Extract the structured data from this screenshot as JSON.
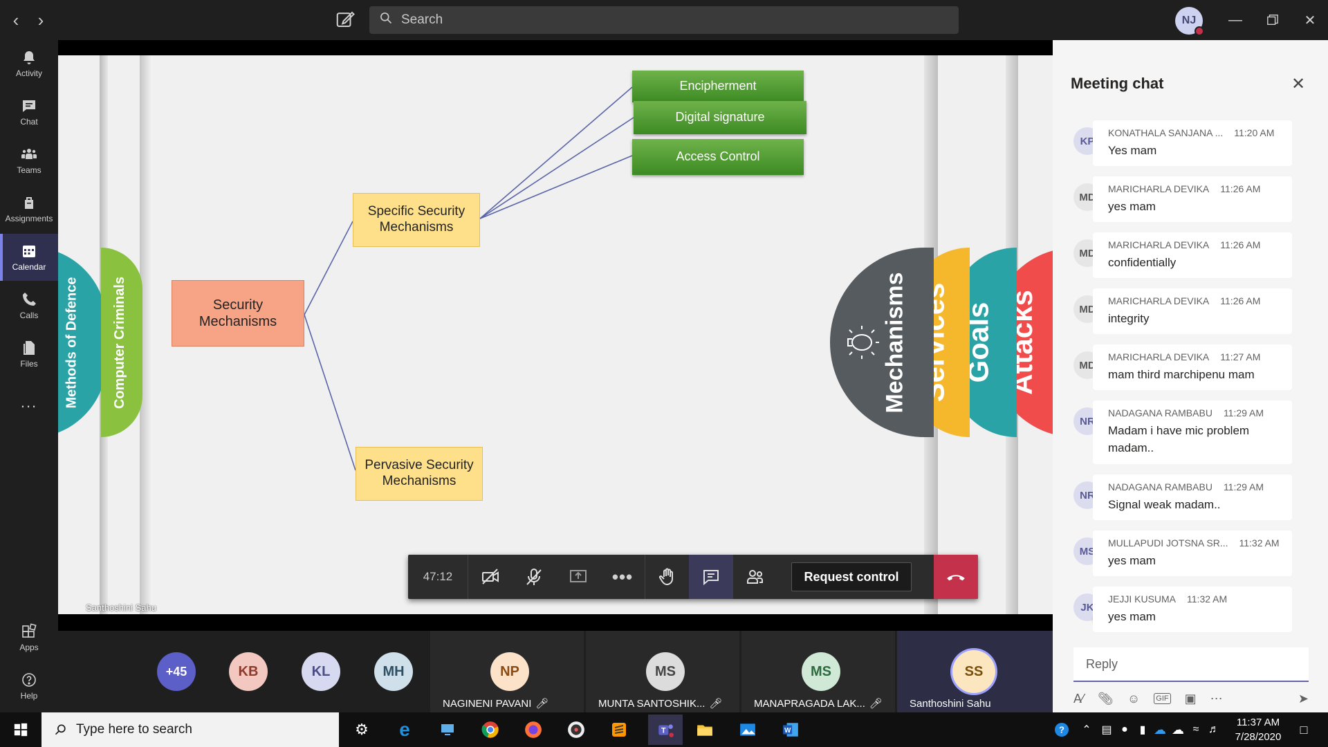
{
  "titlebar": {
    "search_placeholder": "Search",
    "user_initials": "NJ"
  },
  "rail": {
    "items": [
      {
        "label": "Activity",
        "icon": "bell-icon"
      },
      {
        "label": "Chat",
        "icon": "chat-icon"
      },
      {
        "label": "Teams",
        "icon": "teams-icon"
      },
      {
        "label": "Assignments",
        "icon": "assignments-icon"
      },
      {
        "label": "Calendar",
        "icon": "calendar-icon",
        "active": true
      },
      {
        "label": "Calls",
        "icon": "phone-icon"
      },
      {
        "label": "Files",
        "icon": "files-icon"
      }
    ],
    "more": "...",
    "apps_label": "Apps",
    "help_label": "Help"
  },
  "slide": {
    "left_tabs": [
      "Methods of Defence",
      "Computer Criminals"
    ],
    "right_tabs": [
      "Mechanisms",
      "Services",
      "Goals",
      "Attacks"
    ],
    "root": "Security Mechanisms",
    "specific": "Specific Security Mechanisms",
    "pervasive": "Pervasive Security Mechanisms",
    "leaves": [
      "Encipherment",
      "Digital signature",
      "Access Control"
    ],
    "colors": {
      "green": "#4c9a2f",
      "yellow": "#ffe08a",
      "salmon": "#f7a486",
      "teal": "#29a3a6",
      "lime": "#8ac240",
      "gray": "#555b5e",
      "orange": "#f5b72b",
      "red": "#f04c4c"
    }
  },
  "presenter_name": "Santhoshini Sahu",
  "callbar": {
    "timer": "47:12",
    "request_control": "Request control"
  },
  "participants": {
    "overflow": "+45",
    "bubbles": [
      {
        "initials": "KB",
        "bg": "#f2c8c0",
        "fg": "#8d3c2c"
      },
      {
        "initials": "KL",
        "bg": "#d6d9ef",
        "fg": "#4b4d85"
      },
      {
        "initials": "MH",
        "bg": "#cfe0ea",
        "fg": "#2f4f62"
      }
    ],
    "tiles": [
      {
        "initials": "NP",
        "name": "NAGINENI PAVANI",
        "bg": "#fbe2c8",
        "fg": "#8a4b14"
      },
      {
        "initials": "MS",
        "name": "MUNTA SANTOSHIK...",
        "bg": "#dcdcdc",
        "fg": "#444444"
      },
      {
        "initials": "MS",
        "name": "MANAPRAGADA LAK...",
        "bg": "#cfe9d6",
        "fg": "#2c6b3e"
      },
      {
        "initials": "SS",
        "name": "Santhoshini Sahu",
        "bg": "#fbe6c0",
        "fg": "#7a4e0a"
      }
    ]
  },
  "chat": {
    "title": "Meeting chat",
    "messages": [
      {
        "initials": "KP",
        "sender": "KONATHALA SANJANA ...",
        "time": "11:20 AM",
        "text": "Yes mam",
        "status": "busy"
      },
      {
        "initials": "MD",
        "sender": "MARICHARLA DEVIKA",
        "time": "11:26 AM",
        "text": "yes mam",
        "status": "busy",
        "photo": true
      },
      {
        "initials": "MD",
        "sender": "MARICHARLA DEVIKA",
        "time": "11:26 AM",
        "text": "confidentially",
        "status": "busy",
        "photo": true
      },
      {
        "initials": "MD",
        "sender": "MARICHARLA DEVIKA",
        "time": "11:26 AM",
        "text": "integrity",
        "status": "busy",
        "photo": true
      },
      {
        "initials": "MD",
        "sender": "MARICHARLA DEVIKA",
        "time": "11:27 AM",
        "text": "mam third marchipenu mam",
        "status": "busy",
        "photo": true
      },
      {
        "initials": "NR",
        "sender": "NADAGANA RAMBABU",
        "time": "11:29 AM",
        "text": "Madam i have mic problem madam..",
        "status": "none"
      },
      {
        "initials": "NR",
        "sender": "NADAGANA RAMBABU",
        "time": "11:29 AM",
        "text": "Signal weak madam..",
        "status": "none"
      },
      {
        "initials": "MS",
        "sender": "MULLAPUDI JOTSNA SR...",
        "time": "11:32 AM",
        "text": "yes mam",
        "status": "busy"
      },
      {
        "initials": "JK",
        "sender": "JEJJI KUSUMA",
        "time": "11:32 AM",
        "text": "yes mam",
        "status": "available"
      }
    ],
    "reply_placeholder": "Reply"
  },
  "taskbar": {
    "search_placeholder": "Type here to search",
    "time": "11:37 AM",
    "date": "7/28/2020"
  }
}
